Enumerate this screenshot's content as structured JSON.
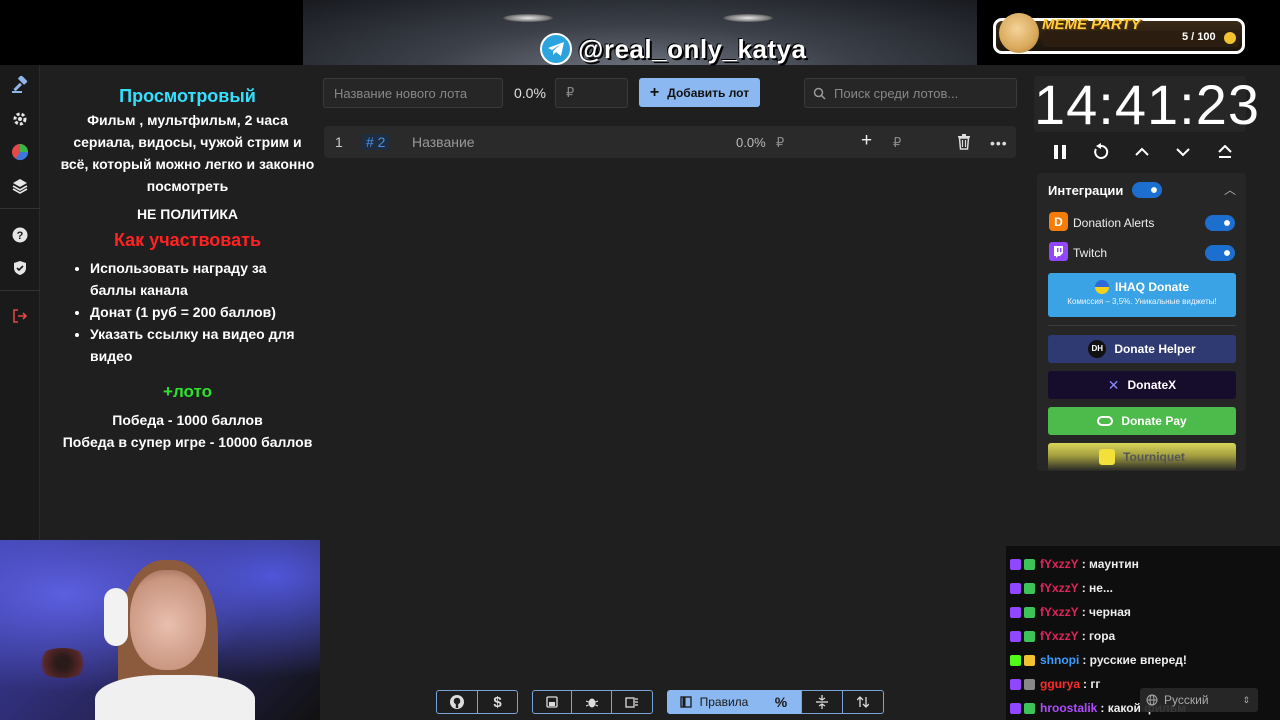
{
  "banner": {
    "telegram_handle": "@real_only_katya",
    "meme_title": "MEME PARTY",
    "meme_count": "5 / 100"
  },
  "sidebar": {
    "items": [
      {
        "icon": "gavel-icon"
      },
      {
        "icon": "gear-icon"
      },
      {
        "icon": "pie-chart-icon"
      },
      {
        "icon": "layers-icon"
      },
      {
        "icon": "help-icon"
      },
      {
        "icon": "shield-icon"
      },
      {
        "icon": "logout-icon"
      }
    ]
  },
  "info": {
    "title": "Просмотровый",
    "description": "Фильм , мультфильм, 2 часа сериала, видосы, чужой стрим и всё, который можно легко и законно посмотреть",
    "not_politics": "НЕ ПОЛИТИКА",
    "how_title": "Как участвовать",
    "how_items": [
      "Использовать награду за баллы канала",
      "Донат (1 руб = 200 баллов)",
      "Указать ссылку на видео для видео"
    ],
    "loto_title": "+лото",
    "win1": "Победа - 1000 баллов",
    "win2": "Победа в супер игре - 10000 баллов"
  },
  "toolbar": {
    "lot_name_placeholder": "Название нового лота",
    "percent": "0.0%",
    "currency_placeholder": "₽",
    "add_label": "Добавить лот",
    "search_placeholder": "Поиск среди лотов..."
  },
  "lot": {
    "index": "1",
    "id": "# 2",
    "name": "Название",
    "percent": "0.0%",
    "currency": "₽",
    "add_currency": "₽"
  },
  "timer": {
    "value": "14:41:23"
  },
  "integrations": {
    "title": "Интеграции",
    "items": [
      {
        "name": "Donation Alerts",
        "enabled": true
      },
      {
        "name": "Twitch",
        "enabled": true
      }
    ],
    "ihaq_title": "IHAQ Donate",
    "ihaq_subtitle": "Комиссия – 3,5%. Уникальные виджеты!",
    "donate_helper": "Donate Helper",
    "donatex": "DonateX",
    "donate_pay": "Donate Pay",
    "tourniquet": "Tourniquet"
  },
  "chat": {
    "messages": [
      {
        "user": "fYxzzY",
        "text": ": маунтин",
        "color": "#e0245e"
      },
      {
        "user": "fYxzzY",
        "text": ": не...",
        "color": "#e0245e"
      },
      {
        "user": "fYxzzY",
        "text": ": черная",
        "color": "#e0245e"
      },
      {
        "user": "fYxzzY",
        "text": ": гора",
        "color": "#e0245e"
      },
      {
        "user": "shnopi",
        "text": ": русские вперед!",
        "color": "#3b9dff"
      },
      {
        "user": "ggurya",
        "text": ": гг",
        "color": "#ff2a2a"
      },
      {
        "user": "hroostalik",
        "text": ": какой фильм",
        "color": "#b04cff"
      }
    ],
    "language": "Русский"
  },
  "bottom_bar": {
    "rules_label": "Правила"
  },
  "colors": {
    "accent": "#8bb8f0",
    "toggle": "#1d6fcf",
    "info_title": "#35e0ff",
    "how_title": "#ff2222",
    "loto_title": "#2fe12f"
  }
}
